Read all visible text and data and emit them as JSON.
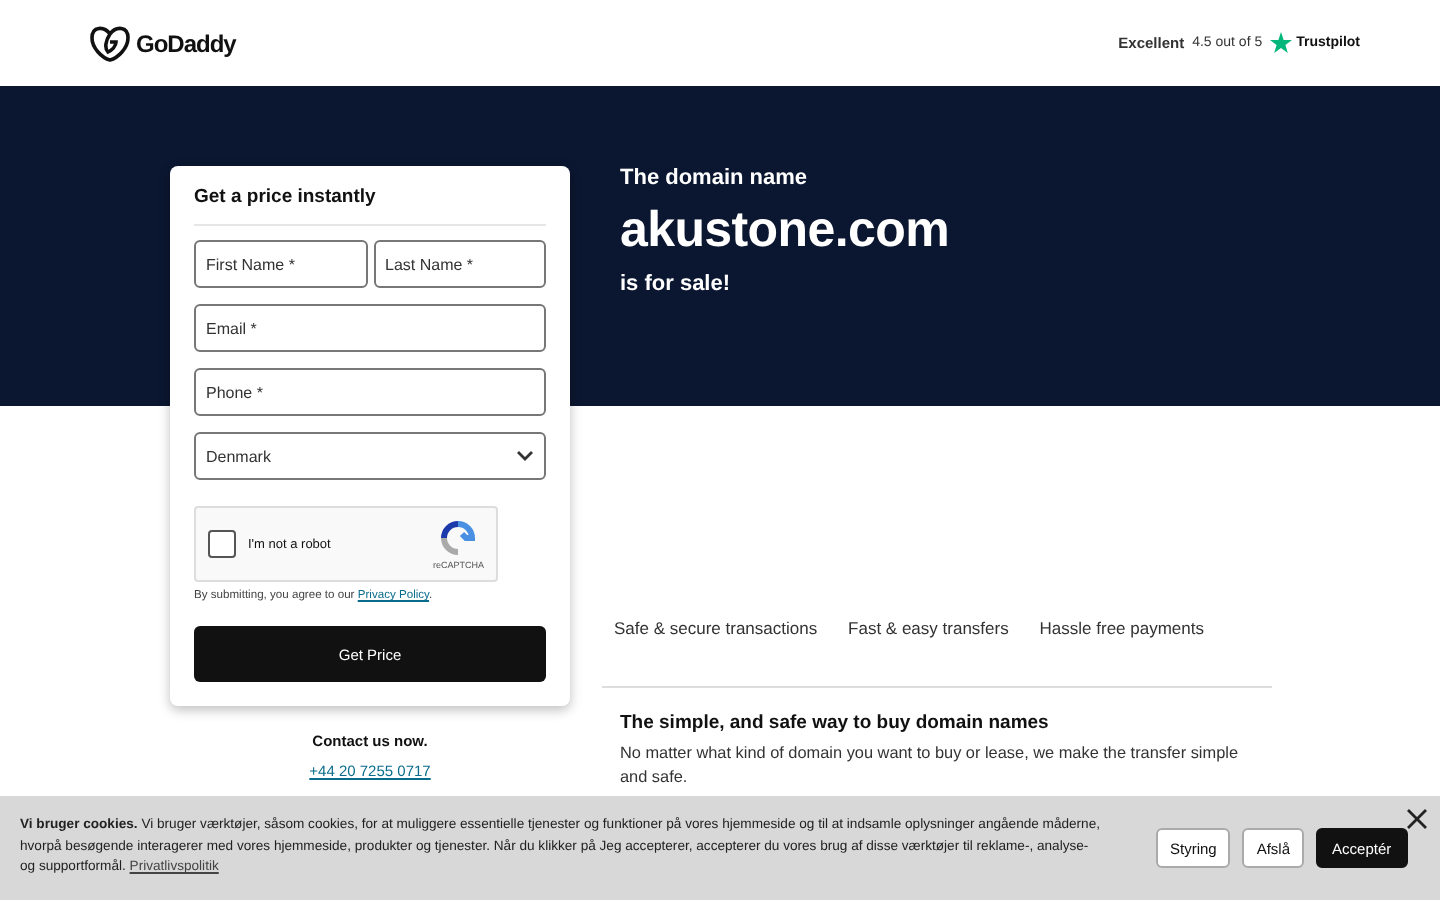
{
  "header": {
    "logo": "GoDaddy",
    "rating_label": "Excellent",
    "rating_score": "4.5 out of 5",
    "rating_source": "Trustpilot"
  },
  "hero": {
    "intro": "The domain name",
    "domain": "akustone.com",
    "outro": "is for sale!"
  },
  "form": {
    "title": "Get a price instantly",
    "rows": [
      {
        "fields": [
          {
            "placeholder": "First Name *",
            "kind": "text"
          },
          {
            "placeholder": "Last Name *",
            "kind": "text"
          }
        ]
      },
      {
        "fields": [
          {
            "placeholder": "Email *",
            "kind": "text"
          }
        ]
      },
      {
        "fields": [
          {
            "placeholder": "Phone *",
            "kind": "text"
          }
        ]
      },
      {
        "fields": [
          {
            "value": "Denmark",
            "kind": "select"
          }
        ]
      }
    ],
    "captcha": {
      "label": "I'm not a robot",
      "brand": "reCAPTCHA",
      "checked": false
    },
    "consent": "By submitting, you agree to our",
    "consent_link": "Privacy Policy",
    "consent_end": ".",
    "submit": "Get Price"
  },
  "contact": {
    "label": "Contact us now.",
    "phone": "+44 20 7255 0717"
  },
  "features": [
    "Safe & secure transactions",
    "Fast & easy transfers",
    "Hassle free payments"
  ],
  "info": {
    "title": "The simple, and safe way to buy domain names",
    "body": "No matter what kind of domain you want to buy or lease, we make the transfer simple and safe."
  },
  "cookie_banner": {
    "text": "**Vi bruger cookies.** Vi bruger værktøjer, såsom cookies, for at muliggere essentielle tjenester og funktioner på vores hjemmeside og til at indsamle oplysninger angående måderne, hvorpå besøgende interagerer med vores hjemmeside, produkter og tjenester. Når du klikker på Jeg accepterer, accepterer du vores brug af disse værktøjer til reklame-, analyse- og supportformål.",
    "link": "Privatlivspolitik",
    "buttons": [
      {
        "label": "Styring",
        "primary": false
      },
      {
        "label": "Afslå",
        "primary": false
      },
      {
        "label": "Acceptér",
        "primary": true
      }
    ]
  }
}
